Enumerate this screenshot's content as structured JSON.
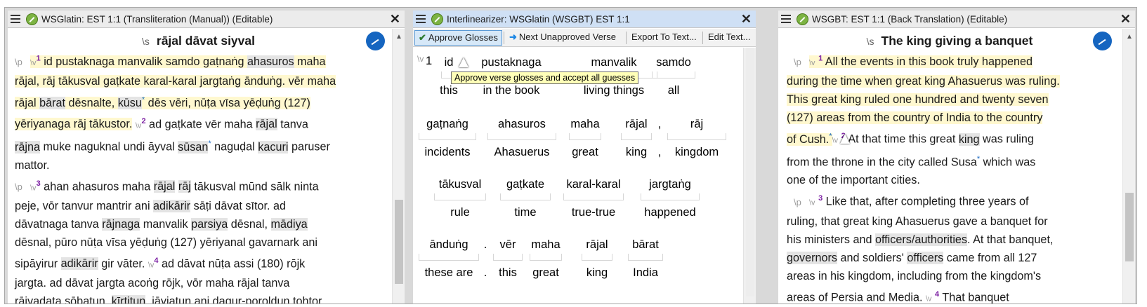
{
  "pane1": {
    "title": "WSGlatin: EST 1:1 (Transliteration (Manual)) (Editable)",
    "heading_marker": "\\s",
    "heading": "rājal dāvat siyval",
    "para_marker": "\\p",
    "verse_marker": "\\v",
    "v1": "1",
    "v2": "2",
    "v3": "3",
    "v4": "4",
    "fn": "*",
    "l1a": "id pustaknaga manvalik samdo gaṭnaṅg ",
    "l1b": "ahasuros",
    "l1c": " maha",
    "l2": "rājal, rāj tākusval gaṭkate karal-karal jargtaṅg ānduṅg. vēr maha",
    "l3a": "rājal ",
    "l3b": "bārat",
    "l3c": " dēsnalte, ",
    "l3d": "kūsu",
    "l3e": " dēs vēri, nūṭa vīsa yēḍuṅg (127)",
    "l4a": "yēriyanaga rāj tākustor.",
    "l4b": " ad gaṭkate vēr maha ",
    "l4c": "rājal",
    "l4d": " tanva",
    "l5a": "rājna",
    "l5b": " muke naguknal undi āyval ",
    "l5c": "sūsan",
    "l5d": " naguḍal ",
    "l5e": "kacuri",
    "l5f": " paruser",
    "l6": "mattor.",
    "l7a": " ahan ahasuros maha ",
    "l7b": "rājal",
    "l7c": " ",
    "l7d": "rāj",
    "l7e": " tākusval mūnd sālk ninta",
    "l8a": "peje, vōr tanvur mantrir ani ",
    "l8b": "adikārir",
    "l8c": " sāṭi dāvat sītor. ad",
    "l9a": "dāvatnaga tanva ",
    "l9b": "rājnaga",
    "l9c": " manvalik ",
    "l9d": "parsiya",
    "l9e": " dēsnal, ",
    "l9f": "mādiya",
    "l10": " dēsnal, pūro nūṭa vīsa yēḍuṅg (127) yēriyanal gavarnark ani",
    "l11a": "sipāyirur ",
    "l11b": "adikārir",
    "l11c": " gir vāter. ",
    "l11d": " ad dāvat nūṭa assi (180) rōjk",
    "l12": "jargta. ad dāvat jargta acoṅg rōjk, vōr maha rājal tanva",
    "l13a": "rājvaḍata sōbatun, ",
    "l13b": "kīrtitun",
    "l13c": ", jāyjatun ani ḍagur-poroldun tohtor."
  },
  "pane2": {
    "title": "Interlinearizer: WSGlatin (WSGBT) EST 1:1",
    "toolbar": {
      "approve": "Approve Glosses",
      "next": "Next Unapproved Verse",
      "export": "Export To Text...",
      "edit": "Edit Text..."
    },
    "tooltip": "Approve verse glosses and accept all guesses",
    "verse_marker": "\\v",
    "verse_num": "1",
    "row1": [
      {
        "w": "id",
        "g": "this"
      },
      {
        "w": "pustaknaga",
        "g": "in the book"
      },
      {
        "w": "manvalik",
        "g": "living things"
      },
      {
        "w": "samdo",
        "g": "all"
      }
    ],
    "row2": [
      {
        "w": "gaṭnaṅg",
        "g": "incidents"
      },
      {
        "w": "ahasuros",
        "g": "Ahasuerus"
      },
      {
        "w": "maha",
        "g": "great"
      },
      {
        "w": "rājal",
        "g": "king"
      },
      {
        "w": ",",
        "g": ","
      },
      {
        "w": "rāj",
        "g": "kingdom"
      }
    ],
    "row3": [
      {
        "w": "tākusval",
        "g": "rule"
      },
      {
        "w": "gaṭkate",
        "g": "time"
      },
      {
        "w": "karal-karal",
        "g": "true-true"
      },
      {
        "w": "jargtaṅg",
        "g": "happened"
      }
    ],
    "row4": [
      {
        "w": "ānduṅg",
        "g": "these are"
      },
      {
        "w": ".",
        "g": "."
      },
      {
        "w": "vēr",
        "g": "this"
      },
      {
        "w": "maha",
        "g": "great"
      },
      {
        "w": "rājal",
        "g": "king"
      },
      {
        "w": "bārat",
        "g": "India"
      }
    ]
  },
  "pane3": {
    "title": "WSGBT: EST 1:1 (Back Translation) (Editable)",
    "heading_marker": "\\s",
    "heading": "The king giving a banquet",
    "para_marker": "\\p",
    "verse_marker": "\\v",
    "v1": "1",
    "v2": "2",
    "v3": "3",
    "v4": "4",
    "fn": "*",
    "l1": "All the events in this book truly happened",
    "l2": "during the time when great king Ahasuerus was ruling.",
    "l3": "This great king ruled one hundred and twenty seven",
    "l4": "(127) areas from the country of India to the country",
    "l5a": "of Cush.",
    "l5b": " At that time this great ",
    "l5c": "king",
    "l5d": "  was ruling",
    "l6a": "from the throne in the city called Susa",
    "l6b": "  which was",
    "l7": "one of the important cities.",
    "l8": " Like that, after completing three years of",
    "l9": "ruling, that great king Ahasuerus gave a banquet for",
    "l10a": "his ministers and ",
    "l10b": "officers/authorities",
    "l10c": ". At that banquet,",
    "l11a": "governors",
    "l11b": "  and soldiers' ",
    "l11c": "officers",
    "l11d": "  came from all 127",
    "l12": "areas in his kingdom, including from the kingdom's",
    "l13a": "areas of Persia and Media.",
    "l13b": " That banquet"
  }
}
